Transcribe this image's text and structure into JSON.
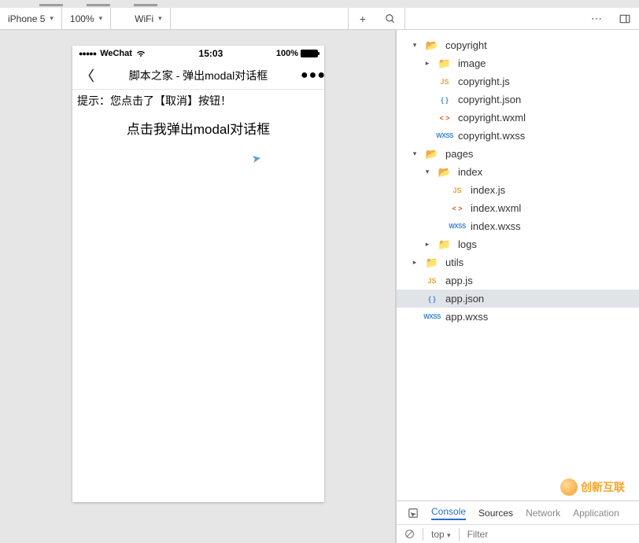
{
  "toolbar": {
    "device": "iPhone 5",
    "zoom": "100%",
    "network": "WiFi",
    "add_tooltip": "+",
    "more": "⋯",
    "dock": "⫿|"
  },
  "simulator": {
    "statusbar": {
      "carrier": "WeChat",
      "time": "15:03",
      "battery_pct": "100%"
    },
    "nav": {
      "title": "脚本之家 - 弹出modal对话框"
    },
    "page": {
      "hint": "提示：您点击了【取消】按钮！",
      "button": "点击我弹出modal对话框"
    }
  },
  "tree": {
    "copyright": {
      "label": "copyright",
      "image": "image",
      "files": {
        "js": "copyright.js",
        "json": "copyright.json",
        "wxml": "copyright.wxml",
        "wxss": "copyright.wxss"
      }
    },
    "pages": {
      "label": "pages",
      "index": {
        "label": "index",
        "files": {
          "js": "index.js",
          "wxml": "index.wxml",
          "wxss": "index.wxss"
        }
      },
      "logs": "logs"
    },
    "utils": "utils",
    "app": {
      "js": "app.js",
      "json": "app.json",
      "wxss": "app.wxss"
    }
  },
  "devtools": {
    "tabs": {
      "console": "Console",
      "sources": "Sources",
      "network": "Network",
      "application": "Application"
    },
    "context": "top",
    "filter_placeholder": "Filter"
  },
  "watermark": {
    "brand": "创新互联"
  }
}
